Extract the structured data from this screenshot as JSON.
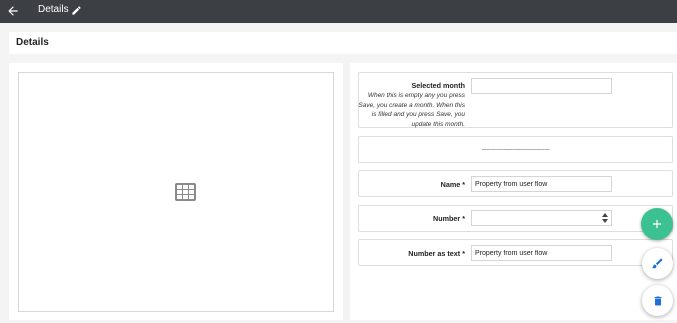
{
  "topbar": {
    "title": "Details",
    "back_icon": "arrow-left-icon",
    "edit_icon": "pencil-icon",
    "background": "#3c3f44"
  },
  "header": {
    "title": "Details"
  },
  "left_panel": {
    "placeholder_icon": "table-grid-icon"
  },
  "form": {
    "selected_month": {
      "label": "Selected month",
      "help": "When this is empty any you press Save, you create a month. When this is filled and you press Save, you update this month.",
      "value": ""
    },
    "separator": "----------------------------------------",
    "name": {
      "label": "Name *",
      "value": "Property from user flow"
    },
    "number": {
      "label": "Number *",
      "value": ""
    },
    "number_as_text": {
      "label": "Number as text *",
      "value": "Property from user flow"
    }
  },
  "fabs": {
    "add_icon": "plus-icon",
    "edit_icon": "brush-icon",
    "delete_icon": "trash-icon",
    "add_color": "#3cc192",
    "edit_color": "#1e6fd9",
    "delete_color": "#1e6fd9"
  }
}
